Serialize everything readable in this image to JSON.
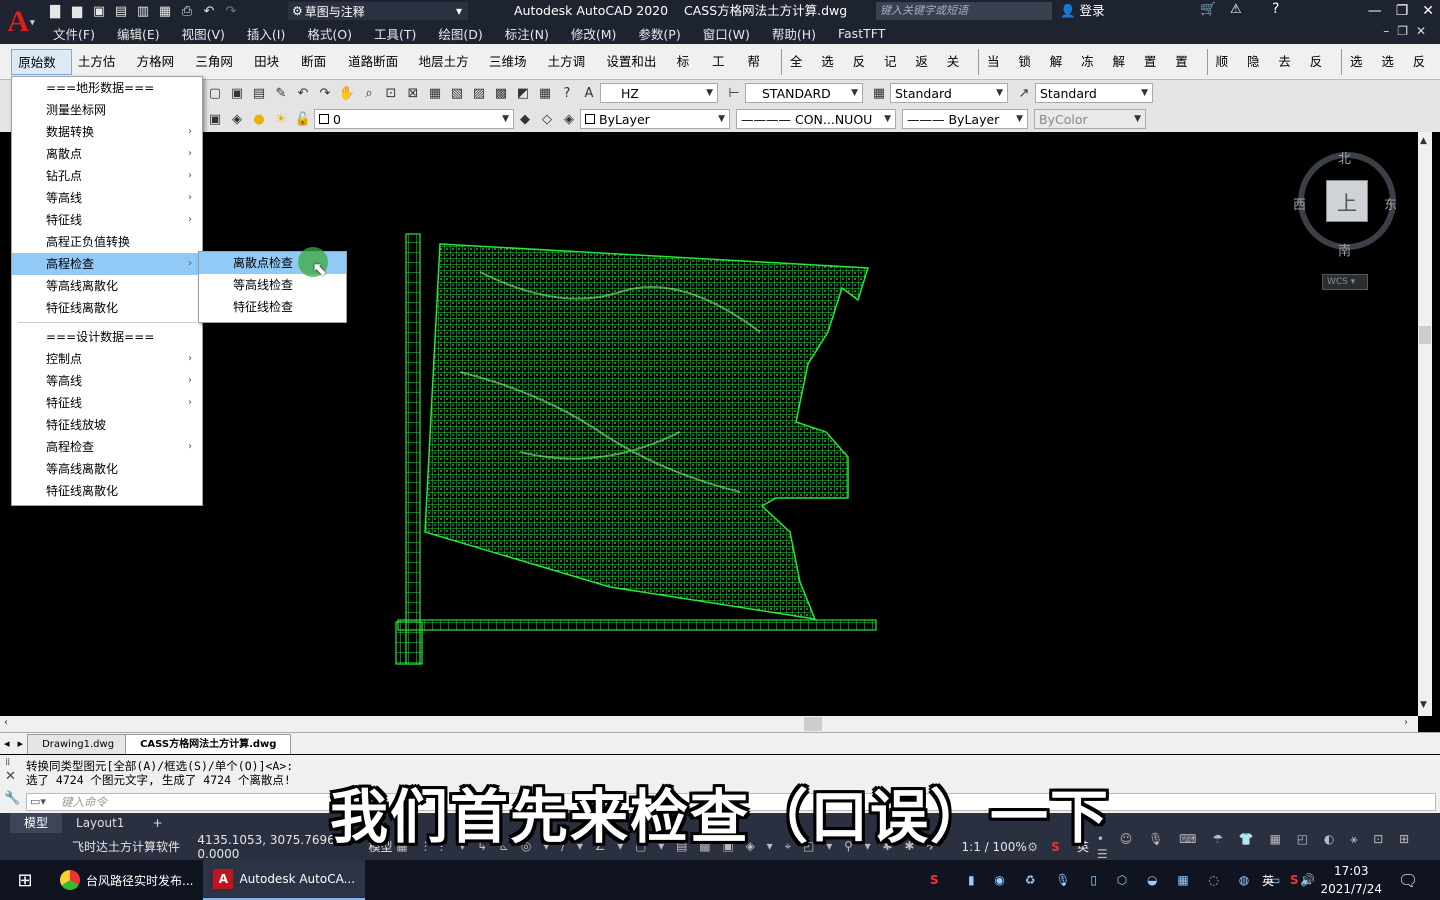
{
  "titlebar": {
    "logo": "A",
    "workspace": "草图与注释",
    "app_title": "Autodesk AutoCAD 2020",
    "doc_title": "CASS方格网法土方计算.dwg",
    "search_placeholder": "键入关键字或短语",
    "login": "登录"
  },
  "menubar": [
    "文件(F)",
    "编辑(E)",
    "视图(V)",
    "插入(I)",
    "格式(O)",
    "工具(T)",
    "绘图(D)",
    "标注(N)",
    "修改(M)",
    "参数(P)",
    "窗口(W)",
    "帮助(H)",
    "FastTFT"
  ],
  "cass_menu": [
    "原始数据",
    "土方估算",
    "方格网法",
    "三角网法",
    "田块法",
    "断面法",
    "道路断面法",
    "地层土方量",
    "三维场地",
    "土方调配",
    "设置和出图",
    "标注",
    "工具",
    "帮助"
  ],
  "layer_tools": [
    "全显",
    "选显",
    "反显",
    "记层",
    "返层",
    "关闭",
    "当前",
    "锁层",
    "解锁",
    "冻层",
    "解冻",
    "置顶",
    "置底",
    "顺序",
    "隐藏",
    "去隐",
    "反隐",
    "选类",
    "选层",
    "反选"
  ],
  "toolbar": {
    "text_style": "HZ",
    "dim_style": "STANDARD",
    "table_style": "Standard",
    "mleader_style": "Standard",
    "layer": "0",
    "color": "ByLayer",
    "linetype": "CON...NUOU",
    "lineweight": "ByLayer",
    "plotstyle": "ByColor"
  },
  "dropdown_main": {
    "items": [
      {
        "label": "===地形数据===",
        "chev": ""
      },
      {
        "label": "测量坐标网",
        "chev": ""
      },
      {
        "label": "数据转换",
        "chev": "›"
      },
      {
        "label": "离散点",
        "chev": "›"
      },
      {
        "label": "钻孔点",
        "chev": "›"
      },
      {
        "label": "等高线",
        "chev": "›"
      },
      {
        "label": "特征线",
        "chev": "›"
      },
      {
        "label": "高程正负值转换",
        "chev": ""
      },
      {
        "label": "高程检查",
        "chev": "›"
      },
      {
        "label": "等高线离散化",
        "chev": ""
      },
      {
        "label": "特征线离散化",
        "chev": ""
      },
      {
        "label": "===设计数据===",
        "chev": ""
      },
      {
        "label": "控制点",
        "chev": "›"
      },
      {
        "label": "等高线",
        "chev": "›"
      },
      {
        "label": "特征线",
        "chev": "›"
      },
      {
        "label": "特征线放坡",
        "chev": ""
      },
      {
        "label": "高程检查",
        "chev": "›"
      },
      {
        "label": "等高线离散化",
        "chev": ""
      },
      {
        "label": "特征线离散化",
        "chev": ""
      }
    ]
  },
  "dropdown_sub": {
    "items": [
      "离散点检查",
      "等高线检查",
      "特征线检查"
    ]
  },
  "viewcube": {
    "n": "北",
    "s": "南",
    "e": "东",
    "w": "西",
    "top": "上",
    "wcs": "WCS"
  },
  "doc_tabs": [
    "Drawing1.dwg",
    "CASS方格网法土方计算.dwg"
  ],
  "command": {
    "line1": "转换同类型图元[全部(A)/框选(S)/单个(O)]<A>:",
    "line2": "选了 4724 个图元文字, 生成了 4724 个离散点!",
    "placeholder": "键入命令"
  },
  "layout_tabs": [
    "模型",
    "Layout1",
    "+"
  ],
  "status": {
    "software": "飞时达土方计算软件",
    "coords": "4135.1053, 3075.7696, 0.0000",
    "mode": "模型",
    "scale": "1:1 / 100%",
    "ime": "英"
  },
  "taskbar": {
    "task1": "台风路径实时发布...",
    "task2": "Autodesk AutoCA...",
    "ime": "英",
    "time": "17:03",
    "date": "2021/7/24"
  },
  "subtitle": "我们首先来检查（口误）一下",
  "colors": {
    "grid": "#22e83a",
    "highlight": "#91c9f7",
    "chrome": "#1e2330"
  }
}
